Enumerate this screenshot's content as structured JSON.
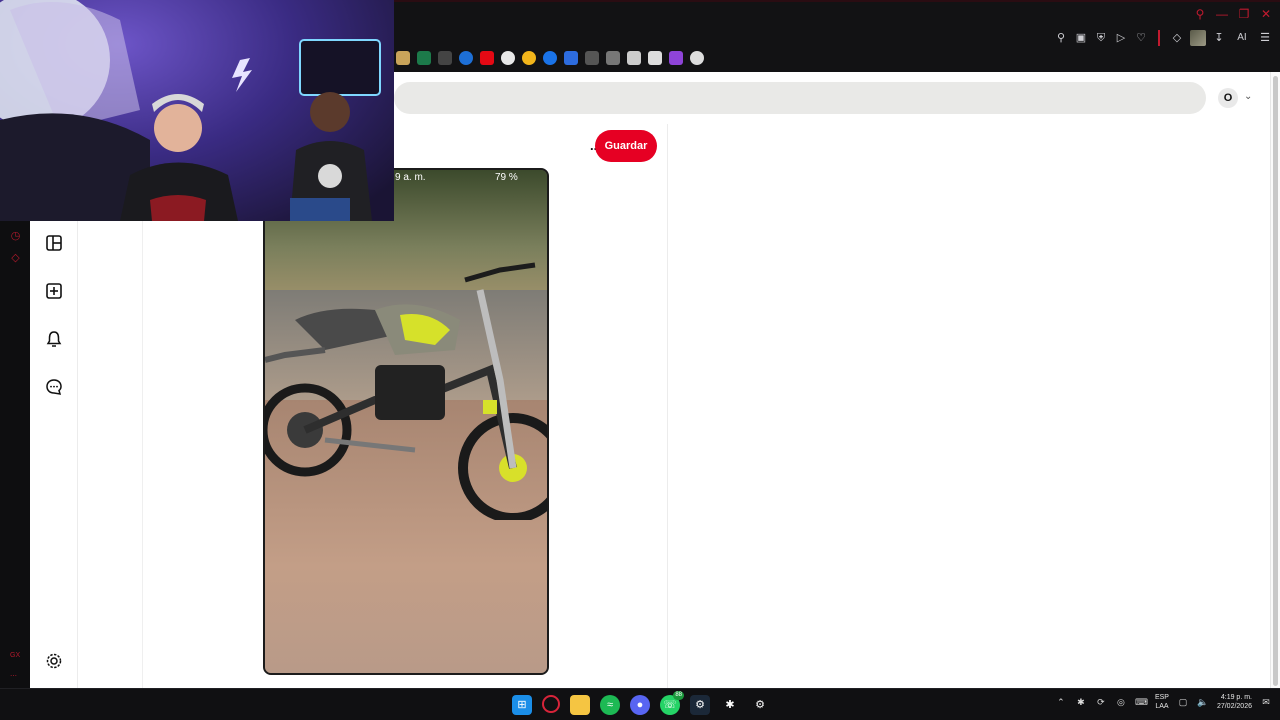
{
  "window": {
    "controls": [
      "search-icon",
      "minimize-icon",
      "restore-icon",
      "close-icon"
    ]
  },
  "toolbar": {
    "ai_label": "AI"
  },
  "bookmarks": [
    {
      "icon": "bookmark-camera-icon",
      "color": "#c9a45a"
    },
    {
      "icon": "bookmark-green-icon",
      "color": "#1c7a4a"
    },
    {
      "icon": "bookmark-gear-icon",
      "color": "#444444"
    },
    {
      "icon": "bookmark-edge-icon",
      "color": "#1d6fd6"
    },
    {
      "icon": "bookmark-netflix-icon",
      "color": "#e50914"
    },
    {
      "icon": "bookmark-google-icon",
      "color": "#e8e8e8"
    },
    {
      "icon": "bookmark-circle-icon",
      "color": "#f2b51b"
    },
    {
      "icon": "bookmark-blue-icon",
      "color": "#1a73e8"
    },
    {
      "icon": "bookmark-play-icon",
      "color": "#2d6cdf"
    },
    {
      "icon": "bookmark-link-icon",
      "color": "#555555"
    },
    {
      "icon": "bookmark-page-icon",
      "color": "#777777"
    },
    {
      "icon": "bookmark-news-icon",
      "color": "#cccccc"
    },
    {
      "icon": "bookmark-doc-icon",
      "color": "#dddddd"
    },
    {
      "icon": "bookmark-purple-icon",
      "color": "#8e44d8"
    },
    {
      "icon": "bookmark-anchor-icon",
      "color": "#dddddd"
    }
  ],
  "header": {
    "avatar_letter": "O"
  },
  "pin": {
    "save_label": "Guardar",
    "more_label": "...",
    "photo_time": "9 a. m.",
    "photo_battery": "79 %"
  },
  "taskbar": {
    "apps": [
      "windows-start-icon",
      "opera-gx-icon",
      "file-explorer-icon",
      "spotify-icon",
      "discord-icon",
      "whatsapp-icon",
      "steam-icon",
      "steelseries-icon",
      "settings-app-icon"
    ],
    "whatsapp_badge": "88",
    "lang_top": "ESP",
    "lang_bottom": "LAA",
    "time": "4:19 p. m.",
    "date": "27/02/2026"
  },
  "colors": {
    "accent_red": "#e60023",
    "gx_red": "#c21a2f"
  }
}
